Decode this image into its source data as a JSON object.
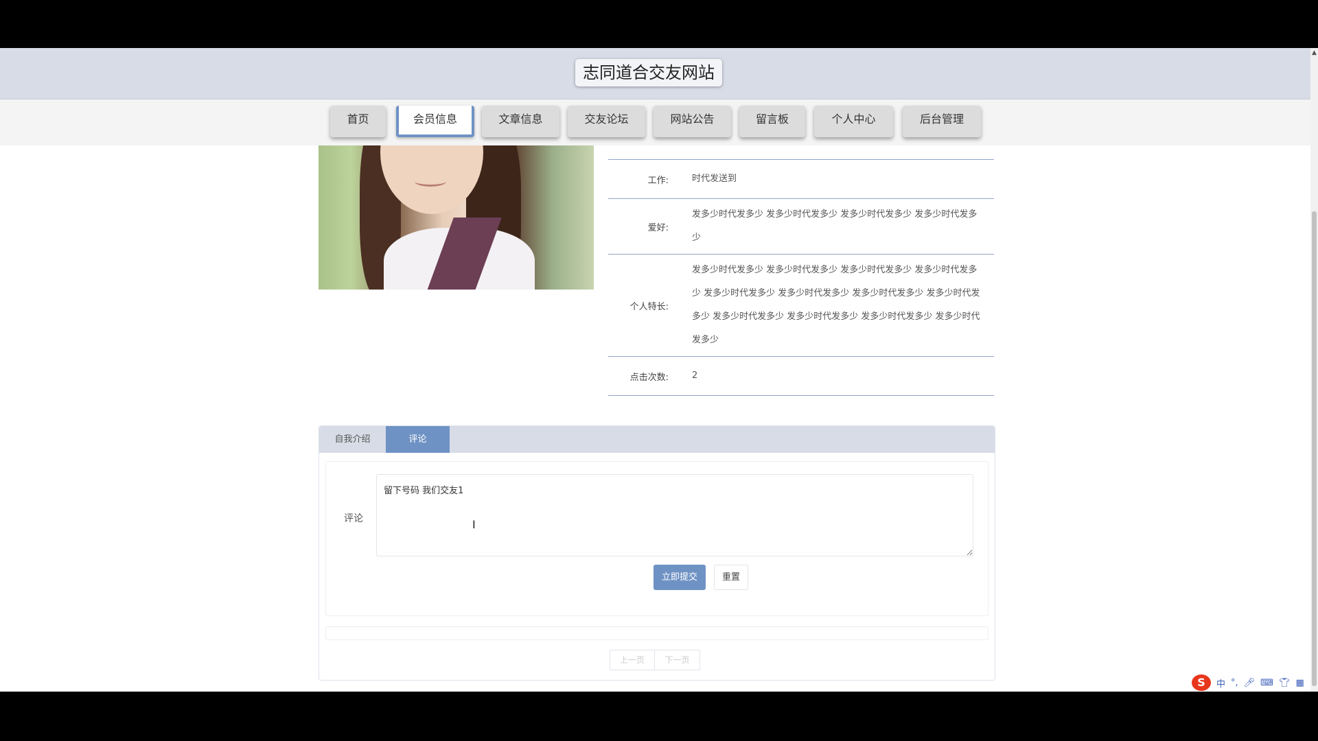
{
  "header": {
    "site_title": "志同道合交友网站"
  },
  "nav": {
    "items": [
      {
        "label": "首页"
      },
      {
        "label": "会员信息"
      },
      {
        "label": "文章信息"
      },
      {
        "label": "交友论坛"
      },
      {
        "label": "网站公告"
      },
      {
        "label": "留言板"
      },
      {
        "label": "个人中心"
      },
      {
        "label": "后台管理"
      }
    ],
    "active": "会员信息"
  },
  "member": {
    "rows": [
      {
        "label": "工作:",
        "value": "时代发送到"
      },
      {
        "label": "爱好:",
        "value": "发多少时代发多少 发多少时代发多少 发多少时代发多少 发多少时代发多少"
      },
      {
        "label": "个人特长:",
        "value": "发多少时代发多少 发多少时代发多少 发多少时代发多少 发多少时代发多少 发多少时代发多少 发多少时代发多少 发多少时代发多少 发多少时代发多少 发多少时代发多少 发多少时代发多少 发多少时代发多少 发多少时代发多少"
      },
      {
        "label": "点击次数:",
        "value": "2"
      }
    ]
  },
  "tabs": {
    "intro": "自我介绍",
    "comment": "评论",
    "active": "评论"
  },
  "comment_form": {
    "label": "评论",
    "value": "留下号码 我们交友1",
    "submit": "立即提交",
    "reset": "重置"
  },
  "pager": {
    "prev": "上一页",
    "next": "下一页"
  },
  "ime": {
    "logo": "S",
    "mode": "中",
    "punct": "°,"
  }
}
